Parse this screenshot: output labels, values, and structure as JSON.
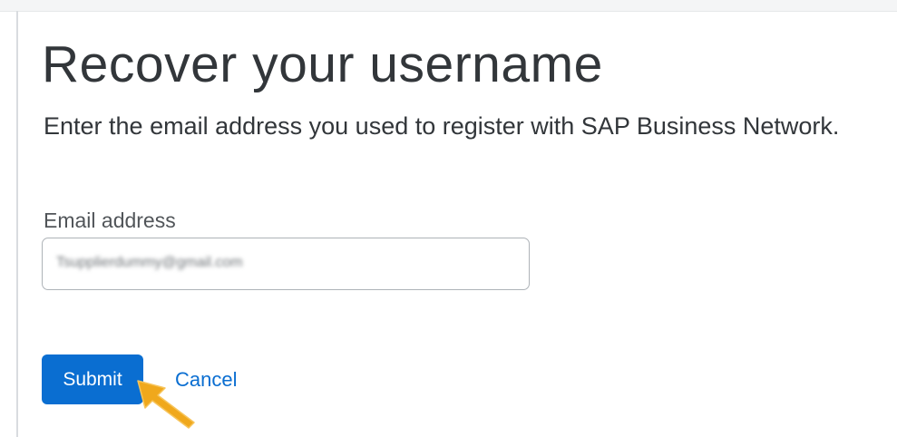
{
  "page": {
    "title": "Recover your username",
    "subtitle": "Enter the email address you used to register with SAP Business Network."
  },
  "form": {
    "email_label": "Email address",
    "email_value": "Tsupplierdummy@gmail.com"
  },
  "actions": {
    "submit_label": "Submit",
    "cancel_label": "Cancel"
  },
  "colors": {
    "accent": "#0a6ed1",
    "text": "#32363a",
    "pointer": "#f0a81c"
  },
  "icons": {
    "pointer": "arrow-pointer-icon"
  }
}
